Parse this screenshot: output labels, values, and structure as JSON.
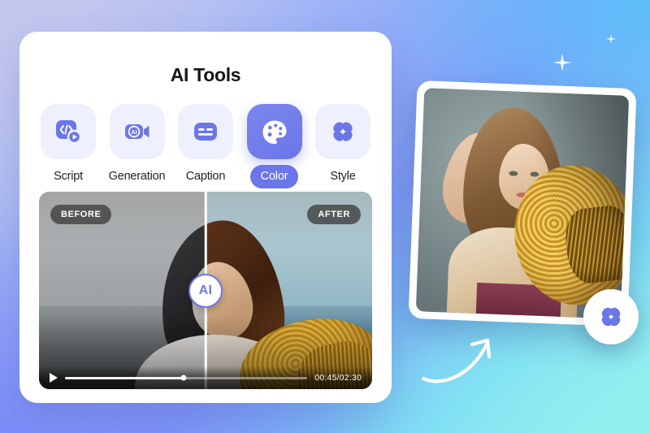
{
  "background": {
    "gradient_from": "#c7cbef",
    "gradient_mid": "#7f9df9",
    "gradient_to": "#9ef0ec",
    "sparkle_color": "#ffffff"
  },
  "theme": {
    "accent": "#6b76e8",
    "accent_light": "#eff0fd",
    "text_dark": "#20222a",
    "card_bg": "#ffffff"
  },
  "panel": {
    "title": "AI Tools",
    "tools": [
      {
        "label": "Script",
        "icon": "code-play-icon",
        "active": false
      },
      {
        "label": "Generation",
        "icon": "ai-video-camera-icon",
        "active": false
      },
      {
        "label": "Caption",
        "icon": "subtitle-icon",
        "active": false
      },
      {
        "label": "Color",
        "icon": "color-palette-icon",
        "active": true
      },
      {
        "label": "Style",
        "icon": "clover-flower-icon",
        "active": false
      }
    ]
  },
  "player": {
    "badge_before": "BEFORE",
    "badge_after": "AFTER",
    "handle_label": "AI",
    "play_icon": "play-icon",
    "time_display": "00:45/02:30",
    "current_time": "00:45",
    "total_time": "02:30",
    "progress_percent": 49,
    "split_percent": 50
  },
  "photo_card": {
    "alt_name": "ai-generated-portrait",
    "fab_icon": "clover-flower-icon"
  },
  "decor": {
    "arrow_name": "curved-arrow-up-right",
    "arrow_color": "#ffffff"
  }
}
